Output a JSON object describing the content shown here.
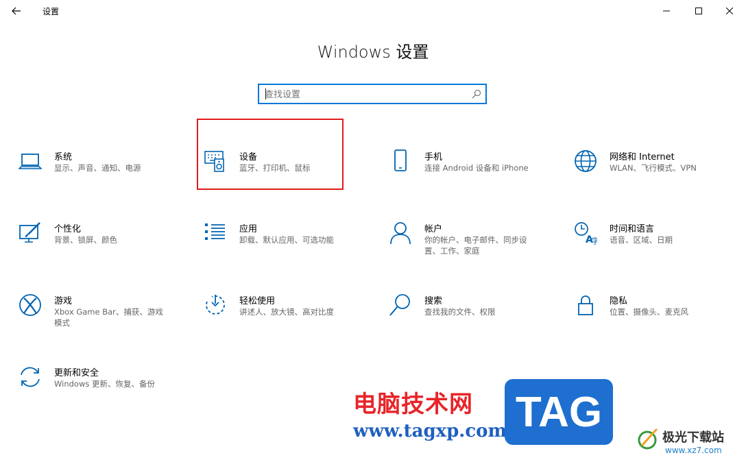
{
  "window": {
    "title": "设置",
    "back_icon": "arrow-left-icon",
    "controls": [
      "minimize-icon",
      "maximize-icon",
      "close-icon"
    ]
  },
  "header": {
    "title": "Windows 设置"
  },
  "search": {
    "placeholder": "查找设置",
    "value": "",
    "icon": "search-icon"
  },
  "accent_color": "#0078d7",
  "highlight_color": "#e01b1b",
  "tiles": [
    {
      "name": "系统",
      "desc": "显示、声音、通知、电源",
      "icon": "laptop-icon"
    },
    {
      "name": "设备",
      "desc": "蓝牙、打印机、鼠标",
      "icon": "keyboard-speaker-icon"
    },
    {
      "name": "手机",
      "desc": "连接 Android 设备和 iPhone",
      "icon": "phone-icon"
    },
    {
      "name": "网络和 Internet",
      "desc": "WLAN、飞行模式、VPN",
      "icon": "globe-icon"
    },
    {
      "name": "个性化",
      "desc": "背景、锁屏、颜色",
      "icon": "paintbrush-monitor-icon"
    },
    {
      "name": "应用",
      "desc": "卸载、默认应用、可选功能",
      "icon": "app-list-icon"
    },
    {
      "name": "帐户",
      "desc": "你的帐户、电子邮件、同步设置、工作、家庭",
      "icon": "person-icon"
    },
    {
      "name": "时间和语言",
      "desc": "语音、区域、日期",
      "icon": "time-language-icon"
    },
    {
      "name": "游戏",
      "desc": "Xbox Game Bar、捕获、游戏模式",
      "icon": "xbox-icon"
    },
    {
      "name": "轻松使用",
      "desc": "讲述人、放大镜、高对比度",
      "icon": "ease-of-access-icon"
    },
    {
      "name": "搜索",
      "desc": "查找我的文件、权限",
      "icon": "magnifier-icon"
    },
    {
      "name": "隐私",
      "desc": "位置、摄像头、麦克风",
      "icon": "lock-icon"
    },
    {
      "name": "更新和安全",
      "desc": "Windows 更新、恢复、备份",
      "icon": "sync-arrows-icon"
    }
  ],
  "watermark": {
    "cn_text": "电脑技术网",
    "url": "www.tagxp.com",
    "tag": "TAG",
    "site_cn": "极光下载站",
    "site_url": "www.xz7.com"
  }
}
